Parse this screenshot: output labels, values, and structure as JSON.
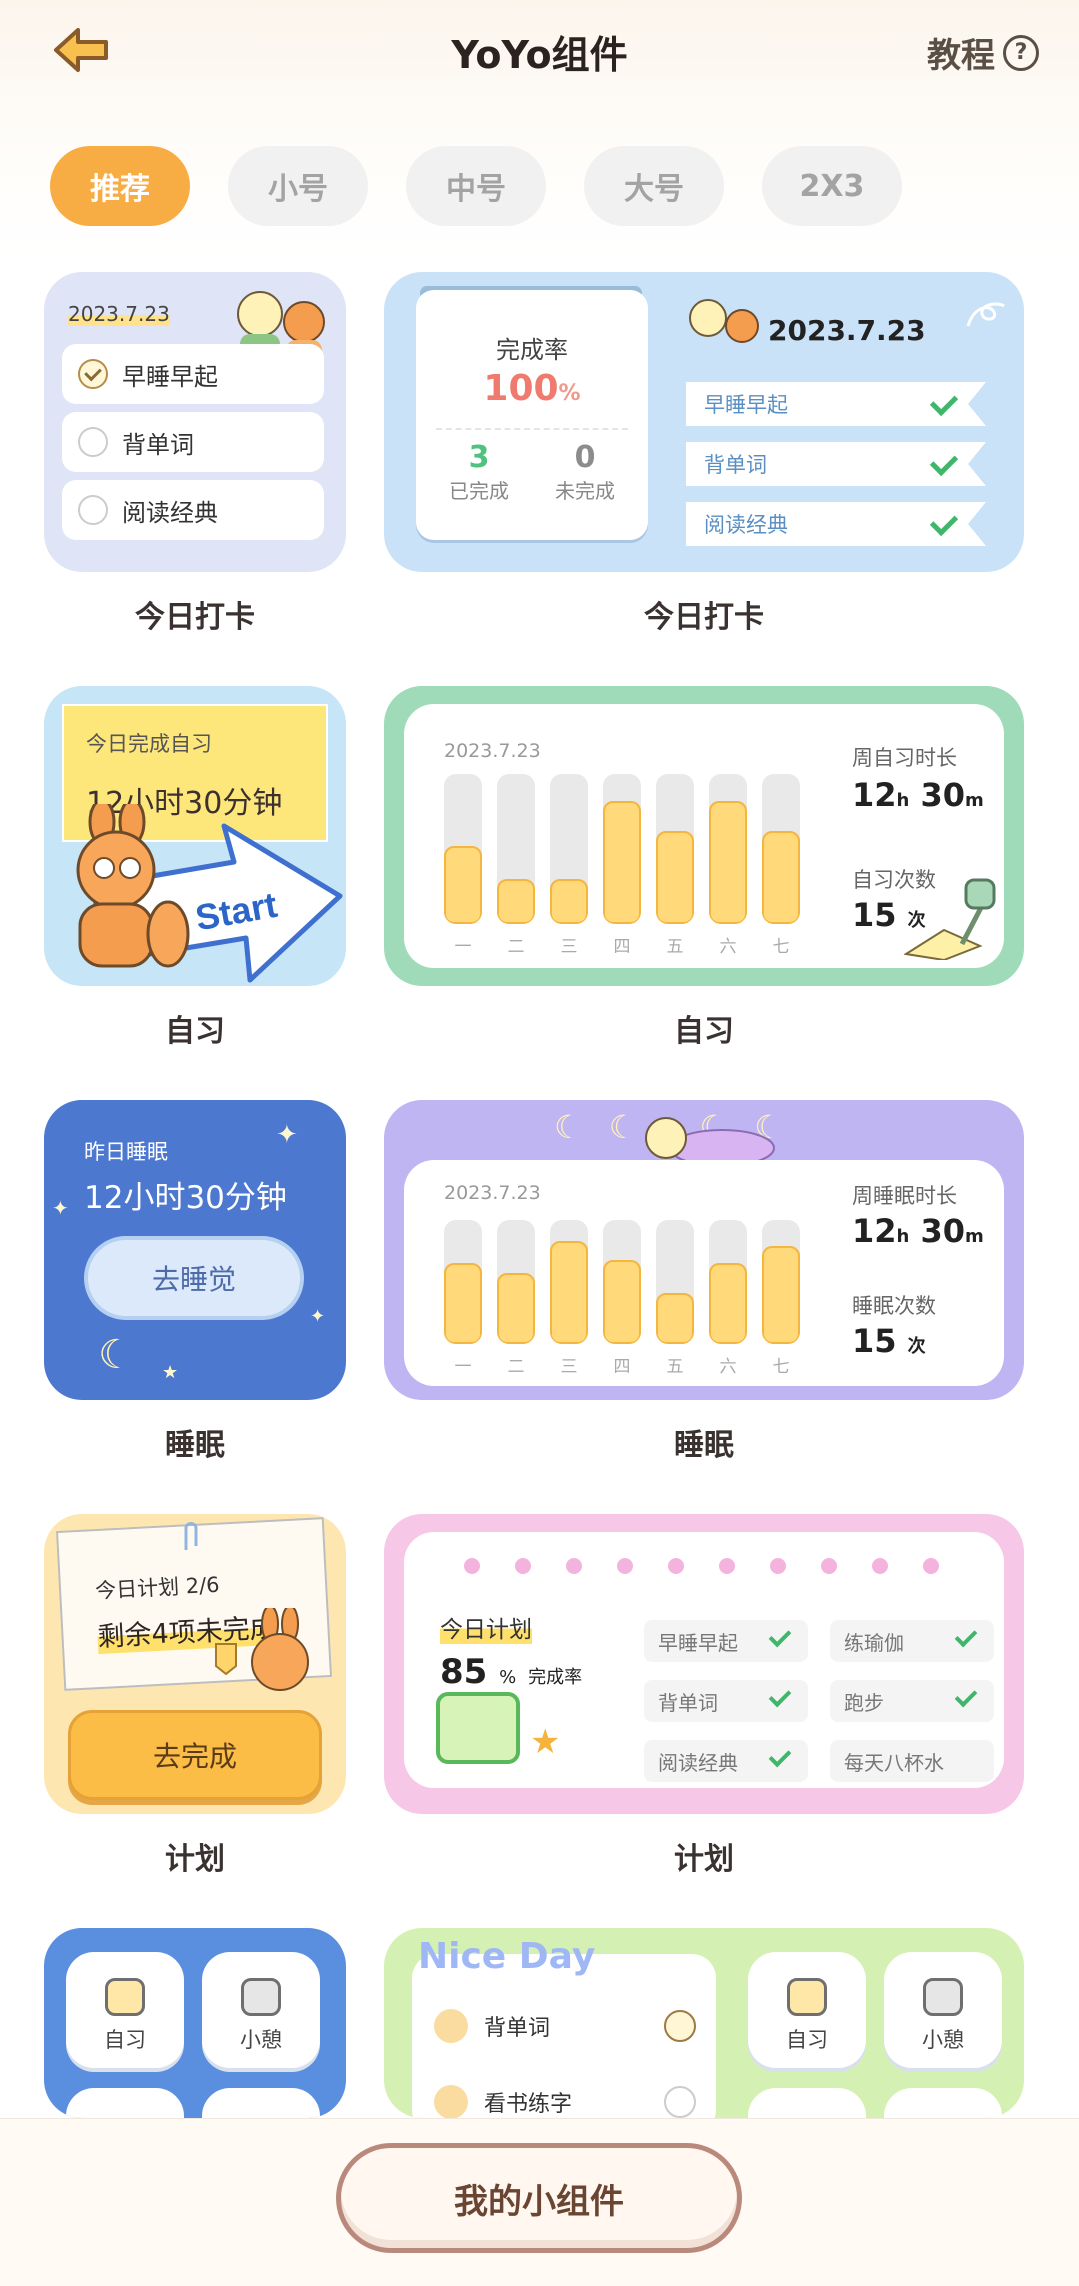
{
  "header": {
    "title": "YoYo组件",
    "tutorial": "教程",
    "help": "?"
  },
  "tabs": [
    "推荐",
    "小号",
    "中号",
    "大号",
    "2X3"
  ],
  "w1": {
    "date": "2023.7.23",
    "items": [
      {
        "label": "早睡早起",
        "checked": true
      },
      {
        "label": "背单词",
        "checked": false
      },
      {
        "label": "阅读经典",
        "checked": false
      }
    ],
    "caption": "今日打卡"
  },
  "w2": {
    "rate_label": "完成率",
    "rate": "100",
    "rate_unit": "%",
    "done": "3",
    "done_label": "已完成",
    "undone": "0",
    "undone_label": "未完成",
    "date": "2023.7.23",
    "items": [
      "早睡早起",
      "背单词",
      "阅读经典"
    ],
    "caption": "今日打卡"
  },
  "w3": {
    "label": "今日完成自习",
    "value": "12小时30分钟",
    "start": "Start",
    "caption": "自习"
  },
  "w4": {
    "date": "2023.7.23",
    "days": [
      "一",
      "二",
      "三",
      "四",
      "五",
      "六",
      "七"
    ],
    "levels": [
      0.52,
      0.3,
      0.3,
      0.82,
      0.62,
      0.82,
      0.62
    ],
    "week_label": "周自习时长",
    "h": "12",
    "hu": "h",
    "m": "30",
    "mu": "m",
    "count_label": "自习次数",
    "count": "15",
    "count_unit": "次",
    "caption": "自习"
  },
  "w5": {
    "label": "昨日睡眠",
    "value": "12小时30分钟",
    "button": "去睡觉",
    "caption": "睡眠"
  },
  "w6": {
    "date": "2023.7.23",
    "days": [
      "一",
      "二",
      "三",
      "四",
      "五",
      "六",
      "七"
    ],
    "levels": [
      0.65,
      0.57,
      0.83,
      0.68,
      0.41,
      0.65,
      0.79
    ],
    "week_label": "周睡眠时长",
    "h": "12",
    "hu": "h",
    "m": "30",
    "mu": "m",
    "count_label": "睡眠次数",
    "count": "15",
    "count_unit": "次",
    "caption": "睡眠"
  },
  "w7": {
    "line1": "今日计划 2/6",
    "line2": "剩余4项未完成",
    "button": "去完成",
    "caption": "计划"
  },
  "w8": {
    "label": "今日计划",
    "value": "85",
    "unit": "%",
    "unit2": "完成率",
    "items": [
      {
        "label": "早睡早起",
        "done": true
      },
      {
        "label": "练瑜伽",
        "done": true
      },
      {
        "label": "背单词",
        "done": true
      },
      {
        "label": "跑步",
        "done": true
      },
      {
        "label": "阅读经典",
        "done": true
      },
      {
        "label": "每天八杯水",
        "done": false
      }
    ],
    "caption": "计划"
  },
  "w9": {
    "tiles": [
      "自习",
      "小憩"
    ]
  },
  "w10": {
    "title": "Nice Day",
    "items": [
      {
        "label": "背单词",
        "checked": true
      },
      {
        "label": "看书练字",
        "checked": false
      }
    ],
    "tiles": [
      "自习",
      "小憩"
    ]
  },
  "bottom": {
    "button": "我的小组件"
  }
}
